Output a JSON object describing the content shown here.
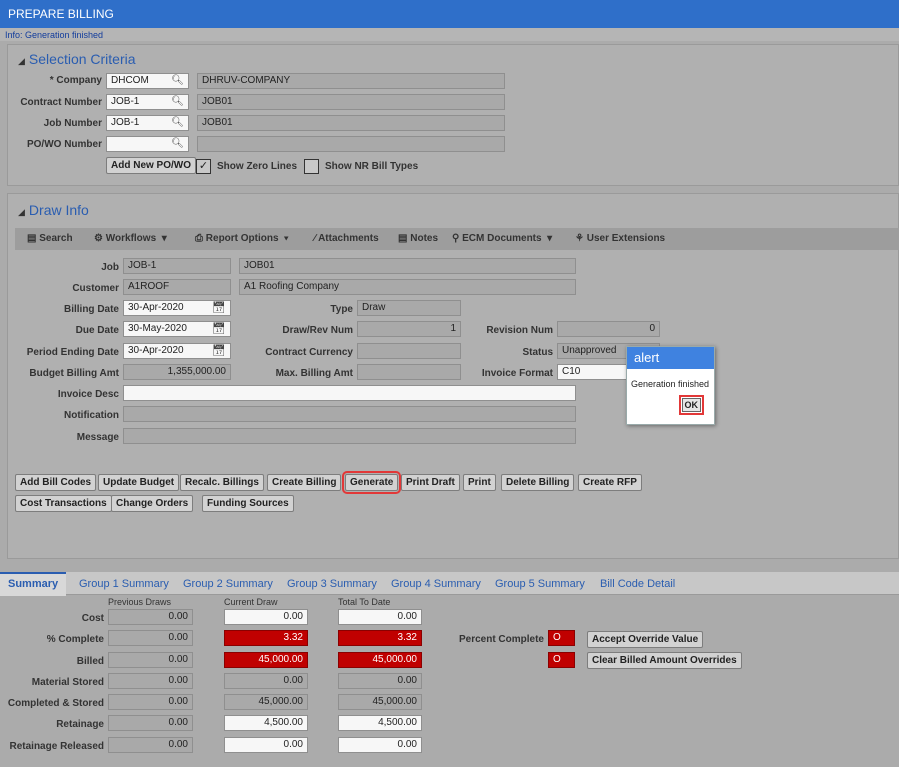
{
  "app": {
    "title": "PREPARE BILLING",
    "info": "Info: Generation finished"
  },
  "selection": {
    "title": "Selection Criteria",
    "company_label": "* Company",
    "company": "DHCOM",
    "company_name": "DHRUV-COMPANY",
    "contract_label": "Contract Number",
    "contract": "JOB-1",
    "contract_name": "JOB01",
    "job_label": "Job Number",
    "job": "JOB-1",
    "job_name": "JOB01",
    "powo_label": "PO/WO Number",
    "powo": "",
    "powo_name": "",
    "add_powo": "Add New PO/WO",
    "show_zero_lines": "Show Zero Lines",
    "show_zero_lines_checked": "✓",
    "show_nr_bill": "Show NR Bill Types"
  },
  "draw": {
    "title": "Draw Info",
    "toolbar": {
      "search": "Search",
      "workflows": "Workflows",
      "report_options": "Report Options",
      "attachments": "Attachments",
      "notes": "Notes",
      "ecm": "ECM Documents",
      "user_ext": "User Extensions"
    },
    "job_label": "Job",
    "job": "JOB-1",
    "job_name": "JOB01",
    "customer_label": "Customer",
    "customer": "A1ROOF",
    "customer_name": "A1 Roofing Company",
    "billing_date_label": "Billing Date",
    "billing_date": "30-Apr-2020",
    "type_label": "Type",
    "type": "Draw",
    "due_date_label": "Due Date",
    "due_date": "30-May-2020",
    "drawrev_label": "Draw/Rev Num",
    "drawrev": "1",
    "revision_label": "Revision Num",
    "revision": "0",
    "period_label": "Period Ending Date",
    "period": "30-Apr-2020",
    "currency_label": "Contract Currency",
    "currency": "",
    "status_label": "Status",
    "status": "Unapproved",
    "budget_label": "Budget Billing Amt",
    "budget": "1,355,000.00",
    "maxbill_label": "Max. Billing Amt",
    "maxbill": "",
    "format_label": "Invoice Format",
    "format": "C10",
    "invdesc_label": "Invoice Desc",
    "invdesc": "",
    "notif_label": "Notification",
    "notif": "",
    "message_label": "Message",
    "message": "",
    "buttons": {
      "add_bill_codes": "Add Bill Codes",
      "update_budget": "Update Budget",
      "recalc": "Recalc. Billings",
      "create_billing": "Create Billing",
      "generate": "Generate",
      "print_draft": "Print Draft",
      "print": "Print",
      "delete_billing": "Delete Billing",
      "create_rfp": "Create RFP",
      "cost_trans": "Cost Transactions",
      "change_orders": "Change Orders",
      "funding": "Funding Sources"
    }
  },
  "tabs": [
    "Summary",
    "Group 1 Summary",
    "Group 2 Summary",
    "Group 3 Summary",
    "Group 4 Summary",
    "Group 5 Summary",
    "Bill Code Detail"
  ],
  "summary": {
    "col_prev": "Previous Draws",
    "col_curr": "Current Draw",
    "col_total": "Total To Date",
    "rows": [
      {
        "label": "Cost",
        "prev": "0.00",
        "curr": "0.00",
        "total": "0.00"
      },
      {
        "label": "% Complete",
        "prev": "0.00",
        "curr": "3.32",
        "total": "3.32"
      },
      {
        "label": "Billed",
        "prev": "0.00",
        "curr": "45,000.00",
        "total": "45,000.00"
      },
      {
        "label": "Material Stored",
        "prev": "0.00",
        "curr": "0.00",
        "total": "0.00"
      },
      {
        "label": "Completed & Stored",
        "prev": "0.00",
        "curr": "45,000.00",
        "total": "45,000.00"
      },
      {
        "label": "Retainage",
        "prev": "0.00",
        "curr": "4,500.00",
        "total": "4,500.00"
      },
      {
        "label": "Retainage Released",
        "prev": "0.00",
        "curr": "0.00",
        "total": "0.00"
      }
    ],
    "percent_complete_label": "Percent Complete",
    "flag1": "O",
    "flag2": "O",
    "accept_override": "Accept Override Value",
    "clear_billed": "Clear Billed Amount Overrides"
  },
  "alert": {
    "title": "alert",
    "message": "Generation finished",
    "ok": "OK"
  }
}
